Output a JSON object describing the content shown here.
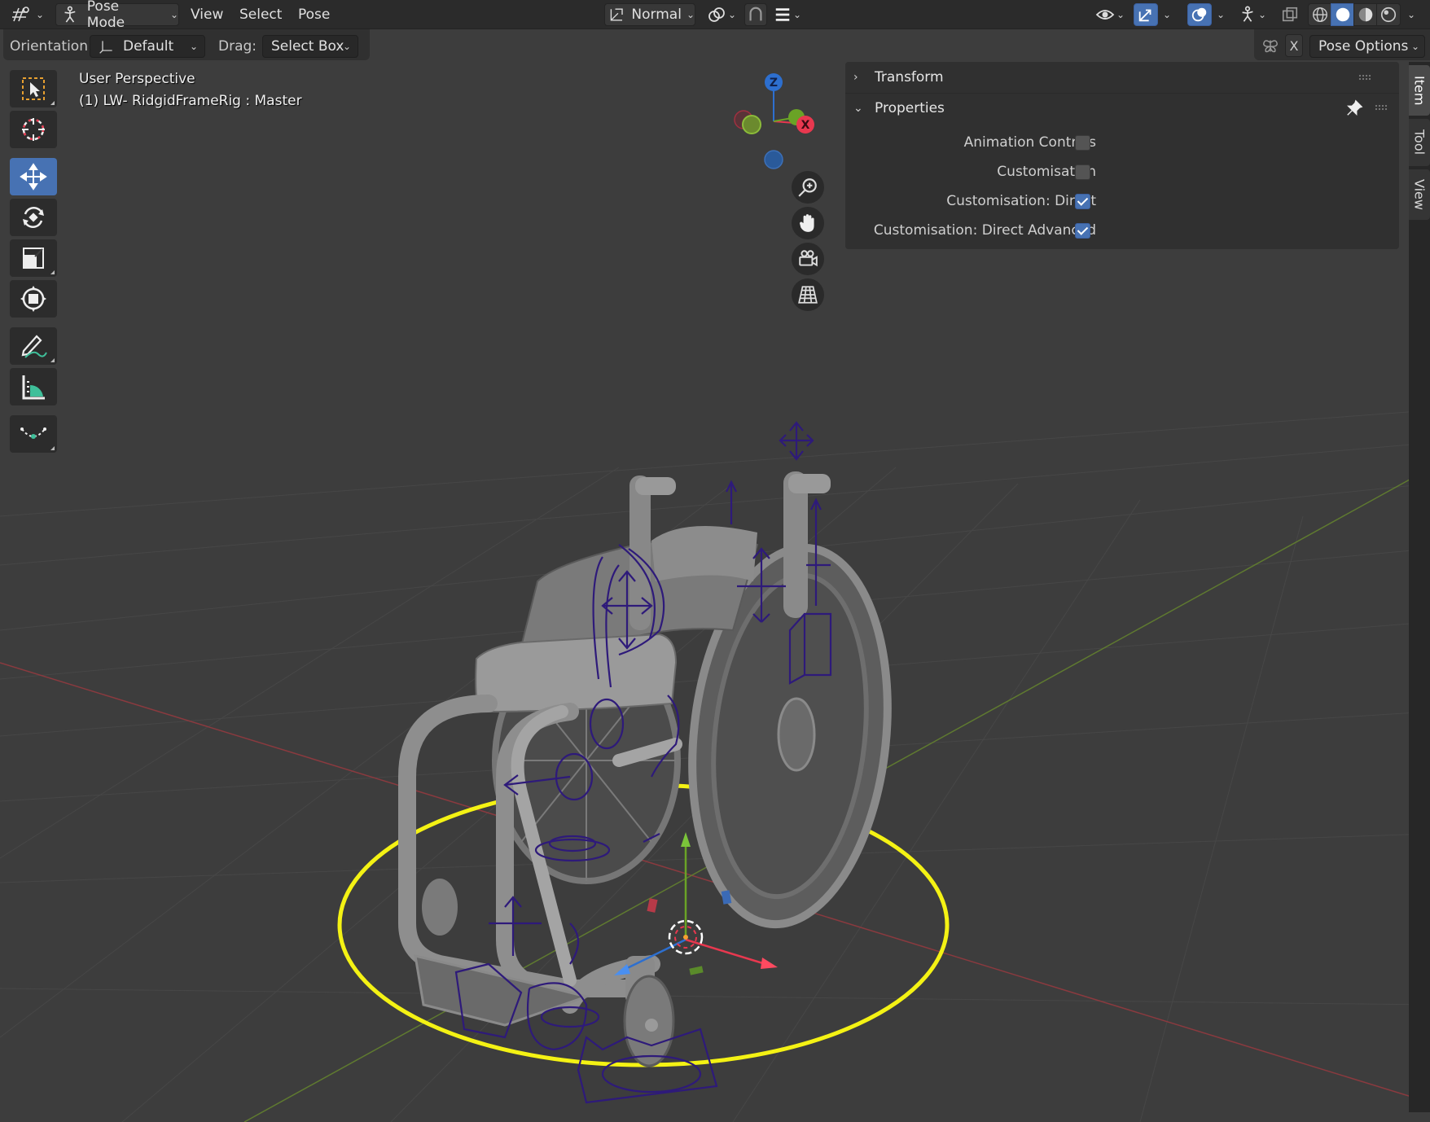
{
  "header": {
    "editor_type_icon": "editor-type-icon",
    "mode": {
      "label": "Pose Mode",
      "icon": "pose-mode-icon"
    },
    "menus": [
      "View",
      "Select",
      "Pose"
    ],
    "transform_orientation": {
      "label": "Normal",
      "icon": "orientation-icon"
    },
    "pivot_icon": "pivot-point-icon",
    "snap_icon": "snap-icon",
    "proportional_icon": "proportional-icon",
    "right_icons": [
      "visibility-icon",
      "gizmo-icon",
      "overlay-icon",
      "bone-overlay-icon",
      "xray-icon",
      "wireframe-shading-icon",
      "solid-shading-icon",
      "material-shading-icon",
      "rendered-shading-icon"
    ]
  },
  "toolrow": {
    "orientation_label": "Orientation:",
    "orientation_value": "Default",
    "drag_label": "Drag:",
    "drag_value": "Select Box",
    "mirror_label": "X",
    "pose_options_label": "Pose Options"
  },
  "viewport": {
    "perspective_label": "User Perspective",
    "object_label": "(1) LW- RidgidFrameRig : Master",
    "gizmo_axes": {
      "z": "Z",
      "x": "X"
    }
  },
  "tools": [
    "select-box-tool",
    "cursor-tool",
    "move-tool",
    "rotate-tool",
    "scale-tool",
    "transform-tool",
    "annotate-tool",
    "measure-tool",
    "relax-pose-tool"
  ],
  "nav_buttons": [
    "zoom-icon",
    "pan-hand-icon",
    "camera-view-icon",
    "ortho-grid-icon"
  ],
  "npanel": {
    "transform_title": "Transform",
    "properties_title": "Properties",
    "properties": [
      {
        "label": "Animation Controls",
        "checked": false
      },
      {
        "label": "Customisation",
        "checked": false
      },
      {
        "label": "Customisation: Direct",
        "checked": true
      },
      {
        "label": "Customisation: Direct Advanced",
        "checked": true
      }
    ]
  },
  "tabs": [
    "Item",
    "Tool",
    "View"
  ],
  "colors": {
    "accent": "#4772b3",
    "header_bg": "#2b2b2b",
    "viewport_bg": "#3d3d3d",
    "selection_circle": "#f4f214",
    "bone_color": "#2e1a7a",
    "axis_x": "#e8384f",
    "axis_y": "#6aa326",
    "axis_z": "#2d6fcf"
  }
}
